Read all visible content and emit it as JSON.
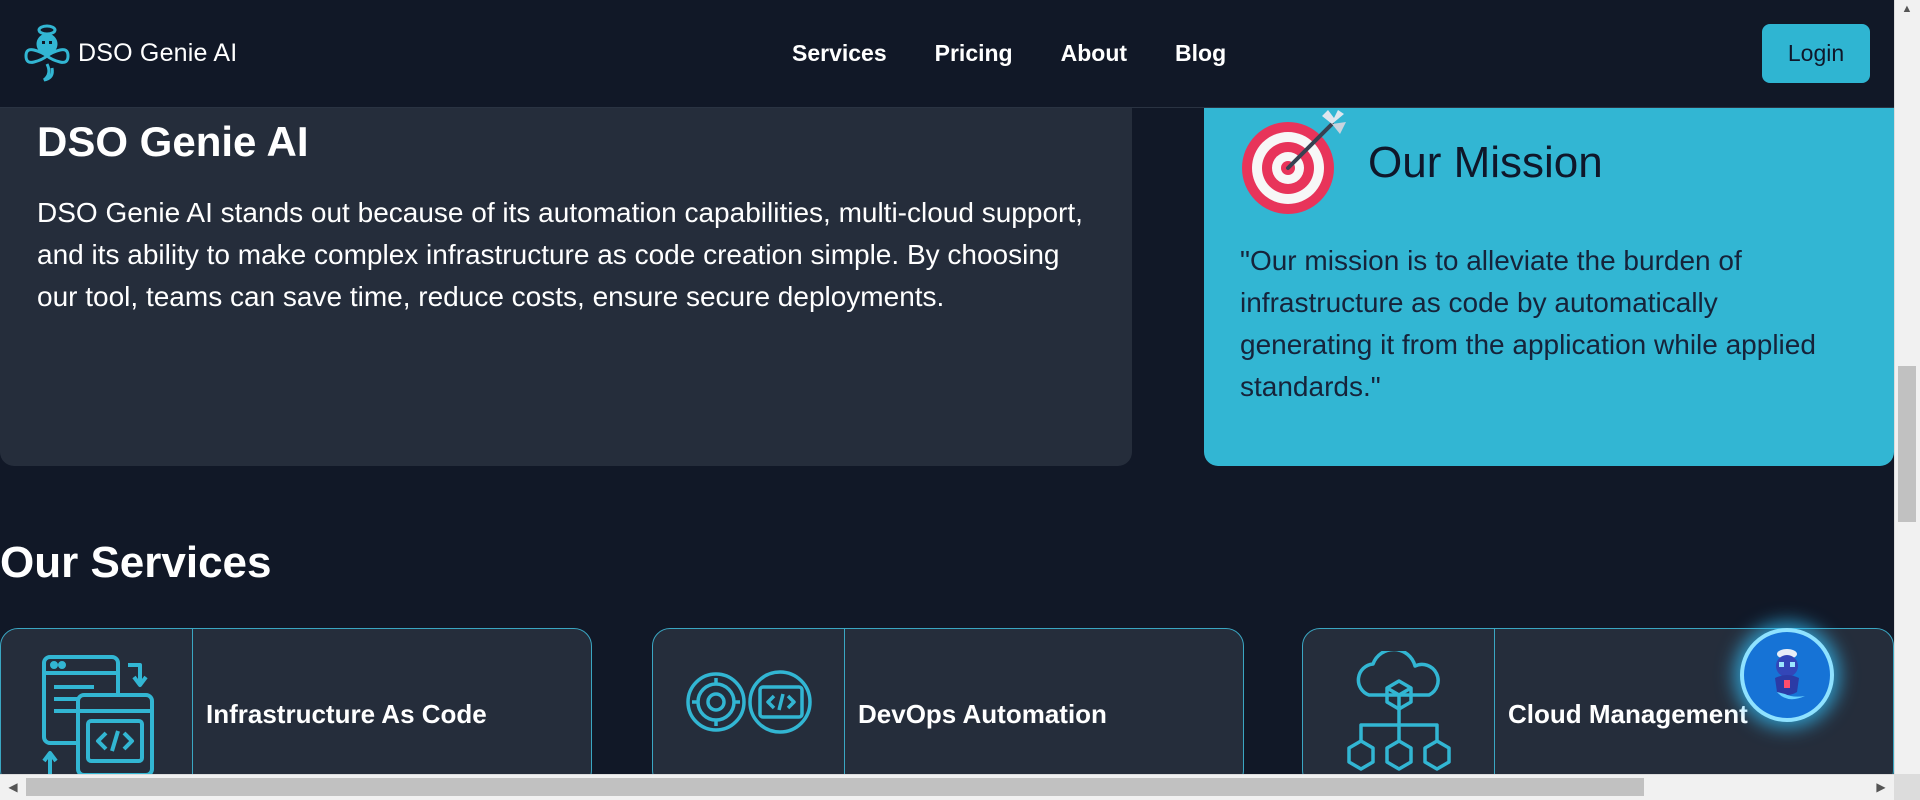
{
  "navbar": {
    "brand": "DSO Genie AI",
    "links": [
      "Services",
      "Pricing",
      "About",
      "Blog"
    ],
    "login_label": "Login"
  },
  "about": {
    "title": "DSO Genie AI",
    "body": "DSO Genie AI stands out because of its automation capabilities, multi-cloud support, and its ability to make complex infrastructure as code creation simple. By choosing our tool, teams can save time, reduce costs, ensure secure deployments."
  },
  "mission": {
    "title": "Our Mission",
    "body": "\"Our mission is to alleviate the burden of infrastructure as code by automatically generating it from the application while applied standards.\""
  },
  "services": {
    "title": "Our Services",
    "items": [
      {
        "name": "Infrastructure As Code",
        "icon": "code-window-icon"
      },
      {
        "name": "DevOps Automation",
        "icon": "gear-code-icon"
      },
      {
        "name": "Cloud Management",
        "icon": "cloud-network-icon"
      }
    ]
  },
  "colors": {
    "page_bg": "#111827",
    "card_bg": "#252d3b",
    "accent": "#32b6d3"
  }
}
